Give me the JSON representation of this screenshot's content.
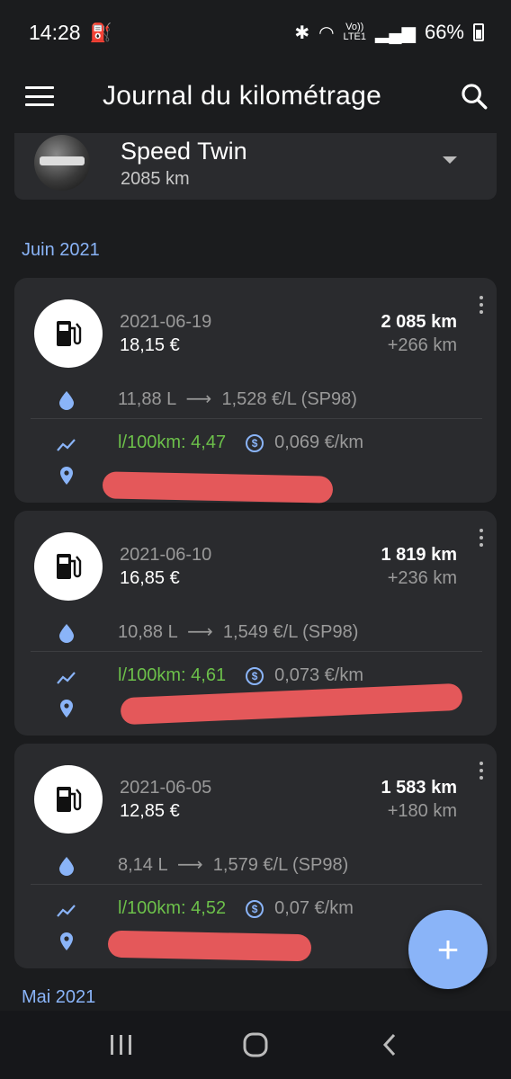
{
  "status_bar": {
    "time": "14:28",
    "network": "LTE1",
    "volte": "Vo))",
    "battery": "66%"
  },
  "app_bar": {
    "title": "Journal du kilométrage"
  },
  "vehicle": {
    "name": "Speed Twin",
    "odometer": "2085 km"
  },
  "months": [
    {
      "label": "Juin 2021"
    },
    {
      "label": "Mai 2021"
    }
  ],
  "entries": [
    {
      "date": "2021-06-19",
      "cost": "18,15 €",
      "odometer": "2 085 km",
      "distance": "+266 km",
      "volume": "11,88 L",
      "price": "1,528 €/L (SP98)",
      "efficiency": "l/100km: 4,47",
      "cost_per_km": "0,069 €/km"
    },
    {
      "date": "2021-06-10",
      "cost": "16,85 €",
      "odometer": "1 819 km",
      "distance": "+236 km",
      "volume": "10,88 L",
      "price": "1,549 €/L (SP98)",
      "efficiency": "l/100km: 4,61",
      "cost_per_km": "0,073 €/km"
    },
    {
      "date": "2021-06-05",
      "cost": "12,85 €",
      "odometer": "1 583 km",
      "distance": "+180 km",
      "volume": "8,14 L",
      "price": "1,579 €/L (SP98)",
      "efficiency": "l/100km: 4,52",
      "cost_per_km": "0,07 €/km"
    }
  ],
  "fab": {
    "label": "+"
  },
  "icons": {
    "menu": "menu-icon",
    "search": "search-icon",
    "fuel": "fuel-pump-icon",
    "drop": "water-drop-icon",
    "trend": "trending-up-icon",
    "location": "location-pin-icon",
    "coin": "coin-icon",
    "more": "more-vert-icon"
  },
  "colors": {
    "background": "#1b1c1e",
    "card": "#2a2b2e",
    "accent": "#8ab4f8",
    "efficiency": "#6cc04a",
    "redaction": "#e4585a"
  }
}
